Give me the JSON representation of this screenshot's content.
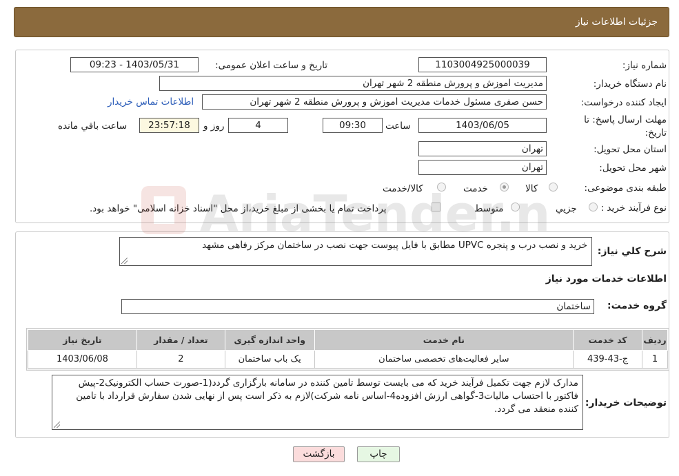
{
  "header": {
    "title": "جزئیات اطلاعات نیاز"
  },
  "info": {
    "need_number_label": "شماره نیاز:",
    "need_number": "1103004925000039",
    "announce_label": "تاریخ و ساعت اعلان عمومی:",
    "announce_value": "1403/05/31 - 09:23",
    "buyer_org_label": "نام دستگاه خریدار:",
    "buyer_org": "مدیریت اموزش و پرورش منطقه 2 شهر تهران",
    "requester_label": "ایجاد کننده درخواست:",
    "requester": "حسن صفری مسئول خدمات مدیریت اموزش و پرورش منطقه 2 شهر تهران",
    "contact_link": "اطلاعات تماس خریدار",
    "deadline_label": "مهلت ارسال پاسخ: تا تاریخ:",
    "deadline_date": "1403/06/05",
    "time_label": "ساعت",
    "deadline_time": "09:30",
    "days_value": "4",
    "days_label": "روز و",
    "remaining_time": "23:57:18",
    "remaining_label": "ساعت باقي مانده",
    "province_label": "استان محل تحویل:",
    "province": "تهران",
    "city_label": "شهر محل تحویل:",
    "city": "تهران",
    "category_label": "طبقه بندی موضوعی:",
    "category_options": [
      "کالا",
      "خدمت",
      "کالا/خدمت"
    ],
    "category_selected": "خدمت",
    "process_label": "نوع فرآیند خرید :",
    "process_options": [
      "جزیي",
      "متوسط"
    ],
    "payment_note": "پرداخت تمام یا بخشی از مبلغ خرید،از محل \"اسناد خزانه اسلامی\" خواهد بود."
  },
  "summary": {
    "label": "شرح کلي نیاز:",
    "text": "خرید و نصب درب و پنجره UPVC مطابق با فایل  پیوست جهت نصب در ساختمان مرکز رفاهی مشهد"
  },
  "services": {
    "section_title": "اطلاعات خدمات مورد نیاز",
    "group_label": "گروه خدمت:",
    "group_value": "ساختمان",
    "table": {
      "headers": [
        "ردیف",
        "کد خدمت",
        "نام خدمت",
        "واحد اندازه گیری",
        "تعداد / مقدار",
        "تاریخ نیاز"
      ],
      "rows": [
        [
          "1",
          "ج-43-439",
          "سایر فعالیت‌های تخصصی ساختمان",
          "یک باب ساختمان",
          "2",
          "1403/06/08"
        ]
      ]
    }
  },
  "buyer_notes": {
    "label": "توضیحات خریدار:",
    "text": "مدارک لازم جهت تکمیل فرآیند خرید که می بایست توسط تامین کننده در سامانه بارگزاری گردد(1-صورت حساب الکترونیک2-پیش فاکتور با احتساب مالیات3-گواهی ارزش افزوده4-اساس نامه شرکت)لازم به ذکر است پس از نهایی شدن سفارش قرارداد با تامین کننده منعقد می گردد."
  },
  "buttons": {
    "print": "چاپ",
    "back": "بازگشت"
  },
  "watermark": {
    "text": "AriaTender.neT"
  },
  "colors": {
    "header_bg": "#8b6a3d",
    "link": "#2b5cb8",
    "back_bg": "#fbdcdc",
    "print_bg": "#e6f7e3"
  }
}
